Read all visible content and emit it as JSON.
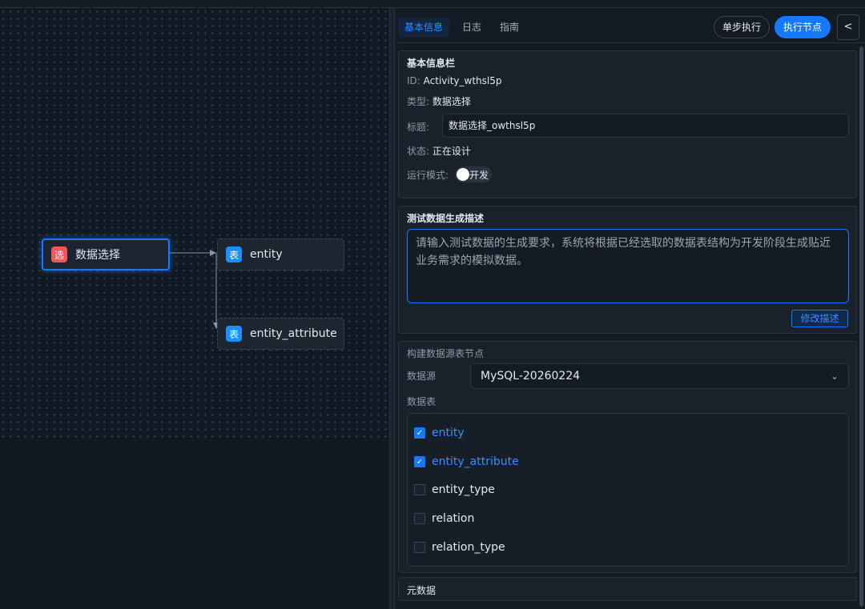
{
  "canvas": {
    "nodes": [
      {
        "badge": "选",
        "label": "数据选择",
        "selected": true
      },
      {
        "badge": "表",
        "label": "entity"
      },
      {
        "badge": "表",
        "label": "entity_attribute"
      }
    ]
  },
  "panel": {
    "tabs": [
      "基本信息",
      "日志",
      "指南"
    ],
    "active_tab": "基本信息",
    "step_button": "单步执行",
    "exec_button": "执行节点",
    "collapse_button": "<",
    "basic": {
      "title": "基本信息栏",
      "id_label": "ID:",
      "id_value": "Activity_wthsl5p",
      "type_label": "类型:",
      "type_value": "数据选择",
      "name_label": "标题:",
      "name_value": "数据选择_owthsl5p",
      "status_label": "状态:",
      "status_value": "正在设计",
      "mode_label": "运行模式:",
      "mode_value": "开发"
    },
    "desc": {
      "title": "测试数据生成描述",
      "placeholder": "请输入测试数据的生成要求，系统将根据已经选取的数据表结构为开发阶段生成贴近业务需求的模拟数据。",
      "modify_button": "修改描述"
    },
    "source": {
      "title": "构建数据源表节点",
      "datasource_label": "数据源",
      "datasource_value": "MySQL-20260224",
      "tables_label": "数据表",
      "tables": [
        {
          "name": "entity",
          "checked": true
        },
        {
          "name": "entity_attribute",
          "checked": true
        },
        {
          "name": "entity_type",
          "checked": false
        },
        {
          "name": "relation",
          "checked": false
        },
        {
          "name": "relation_type",
          "checked": false
        }
      ]
    },
    "meta": {
      "title": "元数据"
    }
  },
  "colors": {
    "accent": "#1677ff",
    "badge_red": "#f0565a",
    "badge_blue": "#1890ff"
  }
}
